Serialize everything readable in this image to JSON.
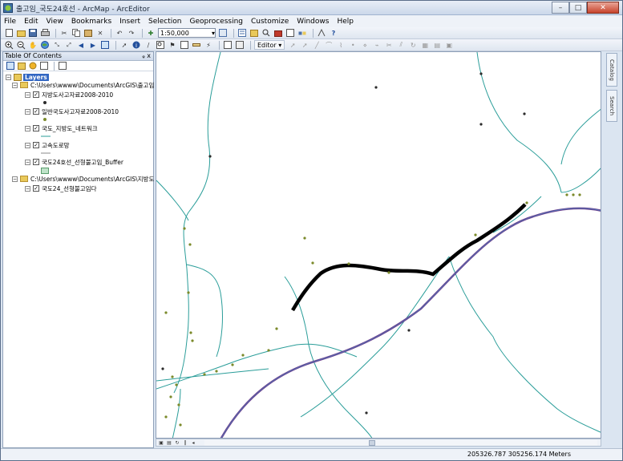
{
  "window": {
    "title": "출고임_국도24호선 - ArcMap - ArcEditor",
    "minimize_symbol": "–",
    "maximize_symbol": "□",
    "close_symbol": "✕"
  },
  "menu": [
    "File",
    "Edit",
    "View",
    "Bookmarks",
    "Insert",
    "Selection",
    "Geoprocessing",
    "Customize",
    "Windows",
    "Help"
  ],
  "toolbar": {
    "scale": "1:50,000",
    "editor_label": "Editor ▾"
  },
  "toc": {
    "title": "Table Of Contents",
    "pin": "ᵩ x",
    "root_label": "Layers",
    "groups": [
      {
        "path": "C:\\Users\\wwww\\Documents\\ArcGIS\\출고임",
        "layers": [
          {
            "name": "지방도사고자료2008-2010",
            "symbol": "point-black"
          },
          {
            "name": "일반국도사고자료2008-2010",
            "symbol": "point-olive"
          },
          {
            "name": "국도_지방도_네트워크",
            "symbol": "line-teal"
          },
          {
            "name": "고속도로망",
            "symbol": "line-gray"
          },
          {
            "name": "국도24호선_선형불고임_Buffer",
            "symbol": "polygon-green"
          }
        ]
      },
      {
        "path": "C:\\Users\\wwww\\Documents\\ArcGIS\\지방도 사",
        "layers": [
          {
            "name": "국도24_선형불고임다",
            "symbol": "none"
          }
        ]
      }
    ]
  },
  "side_tabs": [
    "Catalog",
    "Search"
  ],
  "status": {
    "coordinates": "205326.787  305256.174 Meters"
  },
  "colors": {
    "road_network": "#2a9d99",
    "highway": "#8a4fa8",
    "buffer_route": "#000000",
    "accident_point_local": "#2b2b2b",
    "accident_point_national": "#7b8a2a",
    "toc_selection": "#3166c2"
  },
  "icons": [
    "arcmap-app-icon",
    "new-icon",
    "open-icon",
    "save-icon",
    "print-icon",
    "cut-icon",
    "copy-icon",
    "paste-icon",
    "delete-icon",
    "undo-icon",
    "redo-icon",
    "add-data-icon",
    "zoom-in-icon",
    "zoom-out-icon",
    "pan-icon",
    "full-extent-icon",
    "select-icon",
    "identify-icon",
    "find-icon",
    "measure-icon",
    "editor-icon"
  ]
}
